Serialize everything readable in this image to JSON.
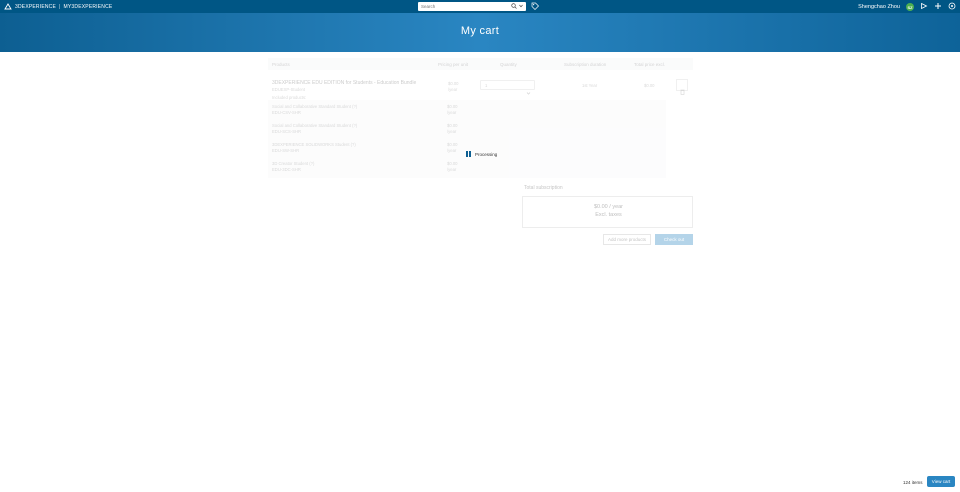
{
  "topbar": {
    "brand_name": "3DEXPERIENCE",
    "brand_sep": "|",
    "brand_app": "MY3DEXPERIENCE",
    "search_placeholder": "Search",
    "user_name": "Shengchao Zhou",
    "user_initials": "SZ"
  },
  "header": {
    "title": "My cart"
  },
  "cart": {
    "columns": [
      "Products",
      "Pricing per unit",
      "Quantity",
      "Subscription duration",
      "Total price excl."
    ],
    "main_item": {
      "name": "3DEXPERIENCE EDU EDITION for Students - Education Bundle",
      "sku_line": "EDUEXP-Student",
      "sub_line": "Included products:",
      "price": "$0.00",
      "price_sub": "/year",
      "quantity": "1",
      "duration": "1st Year",
      "total": "$0.00"
    },
    "sub_items": [
      {
        "name": "Social and Collaborative Standard Student (?)",
        "code": "EDU-CSV-SHR",
        "price": "$0.00",
        "price_sub": "/year"
      },
      {
        "name": "Social and Collaborative Standard Student (?)",
        "code": "EDU-SCS-SHR",
        "price": "$0.00",
        "price_sub": "/year"
      },
      {
        "name": "3DEXPERIENCE SOLIDWORKS Student (?)",
        "code": "EDU-SW-SHR",
        "price": "$0.00",
        "price_sub": "/year"
      },
      {
        "name": "3D Creator Student (?)",
        "code": "EDU-3DC-SHR",
        "price": "$0.00",
        "price_sub": "/year"
      }
    ],
    "loading_text": "Processing"
  },
  "summary": {
    "label": "Total subscription",
    "value_line1": "$0.00 / year",
    "value_line2": "Excl. taxes",
    "add_button": "Add more products",
    "checkout_button": "Check out"
  },
  "footer": {
    "items_count": "124 items",
    "view_cart": "View cart"
  },
  "colors": {
    "topbar": "#005685",
    "accent": "#2a86c2",
    "avatar": "#4caf50"
  }
}
